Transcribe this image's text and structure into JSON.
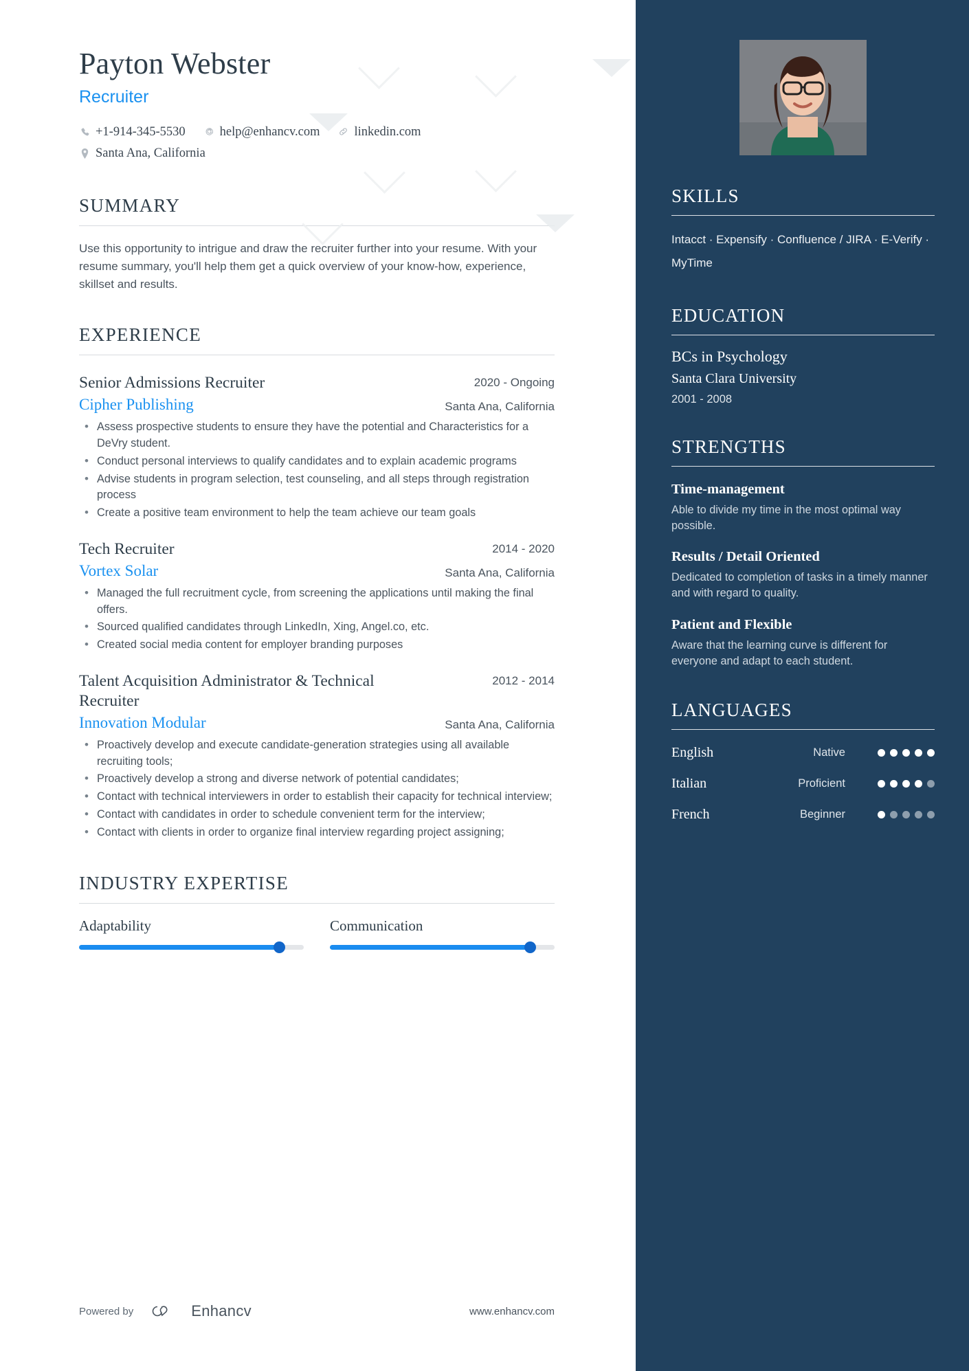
{
  "header": {
    "name": "Payton Webster",
    "role": "Recruiter",
    "contacts": [
      {
        "icon": "phone-icon",
        "text": "+1-914-345-5530"
      },
      {
        "icon": "email-icon",
        "text": "help@enhancv.com"
      },
      {
        "icon": "link-icon",
        "text": "linkedin.com"
      },
      {
        "icon": "location-icon",
        "text": "Santa Ana, California"
      }
    ]
  },
  "summary": {
    "title": "SUMMARY",
    "text": "Use this opportunity to intrigue and draw the recruiter further into your resume. With your resume summary, you'll help them get a quick overview of your know-how, experience, skillset and results."
  },
  "experience": {
    "title": "EXPERIENCE",
    "jobs": [
      {
        "title": "Senior Admissions Recruiter",
        "date": "2020 - Ongoing",
        "company": "Cipher Publishing",
        "location": "Santa Ana, California",
        "bullets": [
          "Assess prospective students to ensure they have the potential and Characteristics for a DeVry student.",
          "Conduct personal interviews to qualify candidates and to explain academic programs",
          "Advise students in program selection, test counseling, and all steps through registration process",
          "Create a positive team environment to help the team achieve our team goals"
        ]
      },
      {
        "title": "Tech Recruiter",
        "date": "2014 - 2020",
        "company": "Vortex Solar",
        "location": "Santa Ana, California",
        "bullets": [
          "Managed the full recruitment cycle, from screening the applications until making the final offers.",
          "Sourced qualified candidates through LinkedIn, Xing, Angel.co, etc.",
          "Created social media content for employer branding purposes"
        ]
      },
      {
        "title": "Talent Acquisition Administrator & Technical Recruiter",
        "date": "2012 - 2014",
        "company": "Innovation Modular",
        "location": "Santa Ana, California",
        "bullets": [
          "Proactively develop and execute candidate-generation strategies using all available recruiting tools;",
          "Proactively develop a strong and diverse network of potential candidates;",
          "Contact with technical interviewers in order to establish their capacity for technical interview;",
          "Contact with candidates in order to schedule convenient term for the interview;",
          "Contact with clients in order to organize final interview regarding project assigning;"
        ]
      }
    ]
  },
  "expertise": {
    "title": "INDUSTRY EXPERTISE",
    "items": [
      {
        "label": "Adaptability",
        "percent": 89
      },
      {
        "label": "Communication",
        "percent": 89
      }
    ]
  },
  "footer": {
    "powered_by": "Powered by",
    "brand": "Enhancv",
    "url": "www.enhancv.com"
  },
  "sidebar": {
    "skills": {
      "title": "SKILLS",
      "text": "Intacct · Expensify · Confluence / JIRA · E-Verify · MyTime"
    },
    "education": {
      "title": "EDUCATION",
      "degree": "BCs in Psychology",
      "school": "Santa Clara University",
      "date": "2001 - 2008"
    },
    "strengths": {
      "title": "STRENGTHS",
      "items": [
        {
          "name": "Time-management",
          "desc": "Able to divide my time in the most optimal way possible."
        },
        {
          "name": "Results / Detail Oriented",
          "desc": "Dedicated to completion of tasks in a timely manner and with regard to quality."
        },
        {
          "name": "Patient and Flexible",
          "desc": "Aware that the learning curve is different for everyone and adapt to each student."
        }
      ]
    },
    "languages": {
      "title": "LANGUAGES",
      "items": [
        {
          "name": "English",
          "level": "Native",
          "rating": 5
        },
        {
          "name": "Italian",
          "level": "Proficient",
          "rating": 4
        },
        {
          "name": "French",
          "level": "Beginner",
          "rating": 1
        }
      ]
    }
  },
  "colors": {
    "accent_blue": "#1a91f0",
    "sidebar_bg": "#21415e",
    "text_dark": "#2e3d49"
  }
}
